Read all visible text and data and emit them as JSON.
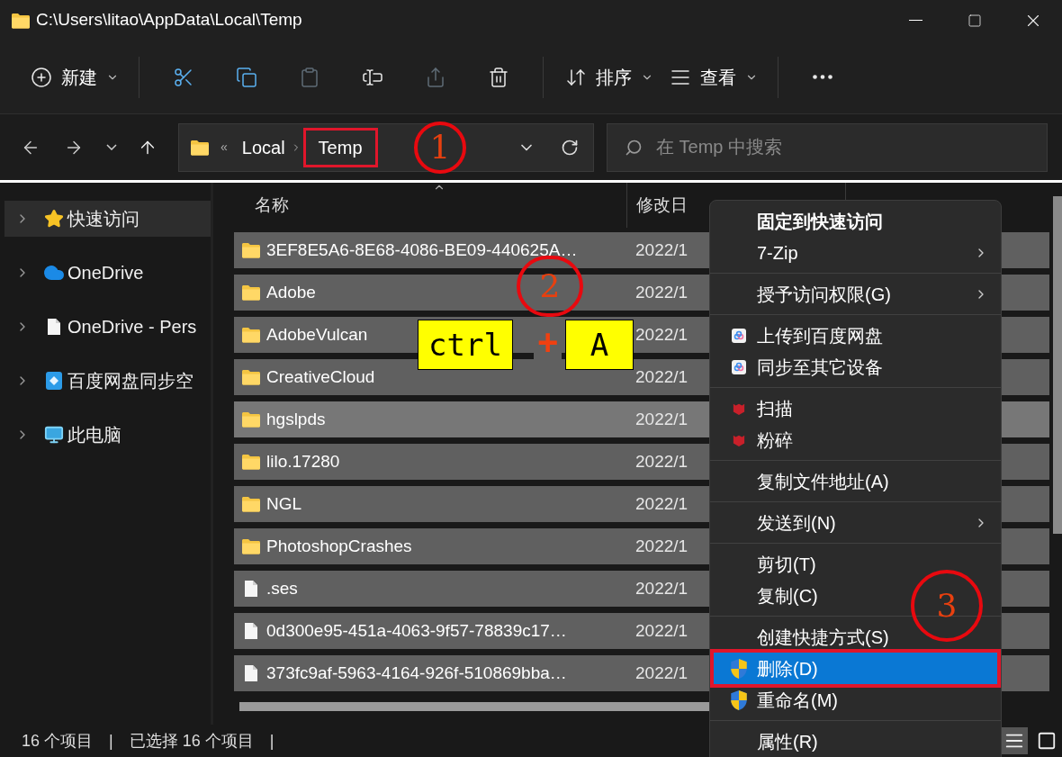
{
  "window": {
    "title": "C:\\Users\\litao\\AppData\\Local\\Temp"
  },
  "toolbar": [
    {
      "kind": "new",
      "label": "新建",
      "disabled": false
    },
    {
      "kind": "cut",
      "disabled": false
    },
    {
      "kind": "copy",
      "disabled": false
    },
    {
      "kind": "paste",
      "disabled": true
    },
    {
      "kind": "rename",
      "disabled": false
    },
    {
      "kind": "share",
      "disabled": true
    },
    {
      "kind": "delete",
      "disabled": false
    },
    {
      "kind": "sort",
      "label": "排序",
      "disabled": false
    },
    {
      "kind": "view",
      "label": "查看",
      "disabled": false
    },
    {
      "kind": "more",
      "disabled": false
    }
  ],
  "address": {
    "overflow": "«",
    "crumbs": [
      {
        "label": "Local",
        "boxed": false
      },
      {
        "label": "Temp",
        "boxed": true
      }
    ]
  },
  "search": {
    "placeholder": "在 Temp 中搜索"
  },
  "sidebar": {
    "items": [
      {
        "label": "快速访问",
        "kind": "star",
        "selected": true
      },
      {
        "label": "OneDrive",
        "kind": "cloud",
        "selected": false
      },
      {
        "label": "OneDrive - Pers",
        "kind": "file",
        "selected": false
      },
      {
        "label": "百度网盘同步空",
        "kind": "sync",
        "selected": false
      },
      {
        "label": "此电脑",
        "kind": "pc",
        "selected": false
      }
    ]
  },
  "table": {
    "columns": [
      "名称",
      "修改日"
    ],
    "rows": [
      {
        "name": "3EF8E5A6-8E68-4086-BE09-440625A…",
        "kind": "folder",
        "date": "2022/1",
        "selected": true,
        "hovered": false
      },
      {
        "name": "Adobe",
        "kind": "folder",
        "date": "2022/1",
        "selected": true,
        "hovered": false
      },
      {
        "name": "AdobeVulcan",
        "kind": "folder",
        "date": "2022/1",
        "selected": true,
        "hovered": false
      },
      {
        "name": "CreativeCloud",
        "kind": "folder",
        "date": "2022/1",
        "selected": true,
        "hovered": false
      },
      {
        "name": "hgslpds",
        "kind": "folder",
        "date": "2022/1",
        "selected": true,
        "hovered": true
      },
      {
        "name": "lilo.17280",
        "kind": "folder",
        "date": "2022/1",
        "selected": true,
        "hovered": false
      },
      {
        "name": "NGL",
        "kind": "folder",
        "date": "2022/1",
        "selected": true,
        "hovered": false
      },
      {
        "name": "PhotoshopCrashes",
        "kind": "folder",
        "date": "2022/1",
        "selected": true,
        "hovered": false
      },
      {
        "name": ".ses",
        "kind": "file",
        "date": "2022/1",
        "selected": true,
        "hovered": false
      },
      {
        "name": "0d300e95-451a-4063-9f57-78839c17…",
        "kind": "file",
        "date": "2022/1",
        "selected": true,
        "hovered": false
      },
      {
        "name": "373fc9af-5963-4164-926f-510869bba…",
        "kind": "file",
        "date": "2022/1",
        "selected": true,
        "hovered": false
      }
    ]
  },
  "context_menu": {
    "items": [
      {
        "kind": "plain",
        "label": "固定到快速访问",
        "bold": true,
        "submenu": false,
        "selected": false,
        "boxed": false
      },
      {
        "kind": "plain",
        "label": "7-Zip",
        "bold": false,
        "submenu": true,
        "selected": false,
        "boxed": false
      },
      {
        "kind": "separator"
      },
      {
        "kind": "plain",
        "label": "授予访问权限(G)",
        "bold": false,
        "submenu": true,
        "selected": false,
        "boxed": false
      },
      {
        "kind": "separator"
      },
      {
        "kind": "cloudapp",
        "label": "上传到百度网盘",
        "bold": false,
        "submenu": false,
        "selected": false,
        "boxed": false
      },
      {
        "kind": "cloudapp",
        "label": "同步至其它设备",
        "bold": false,
        "submenu": false,
        "selected": false,
        "boxed": false
      },
      {
        "kind": "separator"
      },
      {
        "kind": "antivirus",
        "label": "扫描",
        "bold": false,
        "submenu": false,
        "selected": false,
        "boxed": false
      },
      {
        "kind": "antivirus",
        "label": "粉碎",
        "bold": false,
        "submenu": false,
        "selected": false,
        "boxed": false
      },
      {
        "kind": "separator"
      },
      {
        "kind": "plain",
        "label": "复制文件地址(A)",
        "bold": false,
        "submenu": false,
        "selected": false,
        "boxed": false
      },
      {
        "kind": "separator"
      },
      {
        "kind": "plain",
        "label": "发送到(N)",
        "bold": false,
        "submenu": true,
        "selected": false,
        "boxed": false
      },
      {
        "kind": "separator"
      },
      {
        "kind": "plain",
        "label": "剪切(T)",
        "bold": false,
        "submenu": false,
        "selected": false,
        "boxed": false
      },
      {
        "kind": "plain",
        "label": "复制(C)",
        "bold": false,
        "submenu": false,
        "selected": false,
        "boxed": false
      },
      {
        "kind": "separator"
      },
      {
        "kind": "plain",
        "label": "创建快捷方式(S)",
        "bold": false,
        "submenu": false,
        "selected": false,
        "boxed": false
      },
      {
        "kind": "admin",
        "label": "删除(D)",
        "bold": false,
        "submenu": false,
        "selected": true,
        "boxed": true
      },
      {
        "kind": "admin",
        "label": "重命名(M)",
        "bold": false,
        "submenu": false,
        "selected": false,
        "boxed": false
      },
      {
        "kind": "separator"
      },
      {
        "kind": "plain",
        "label": "属性(R)",
        "bold": false,
        "submenu": false,
        "selected": false,
        "boxed": false
      }
    ]
  },
  "status_bar": {
    "items": [
      "16 个项目",
      "|",
      "已选择 16 个项目",
      "|"
    ],
    "views": [
      {
        "kind": "details",
        "selected": true
      },
      {
        "kind": "tiles",
        "selected": false
      }
    ]
  },
  "annotations": [
    {
      "kind": "circle",
      "text": "1"
    },
    {
      "kind": "circle",
      "text": "2"
    },
    {
      "kind": "key",
      "text": "ctrl"
    },
    {
      "kind": "plus",
      "text": "+"
    },
    {
      "kind": "key",
      "text": "A"
    },
    {
      "kind": "circle",
      "text": "3"
    }
  ]
}
